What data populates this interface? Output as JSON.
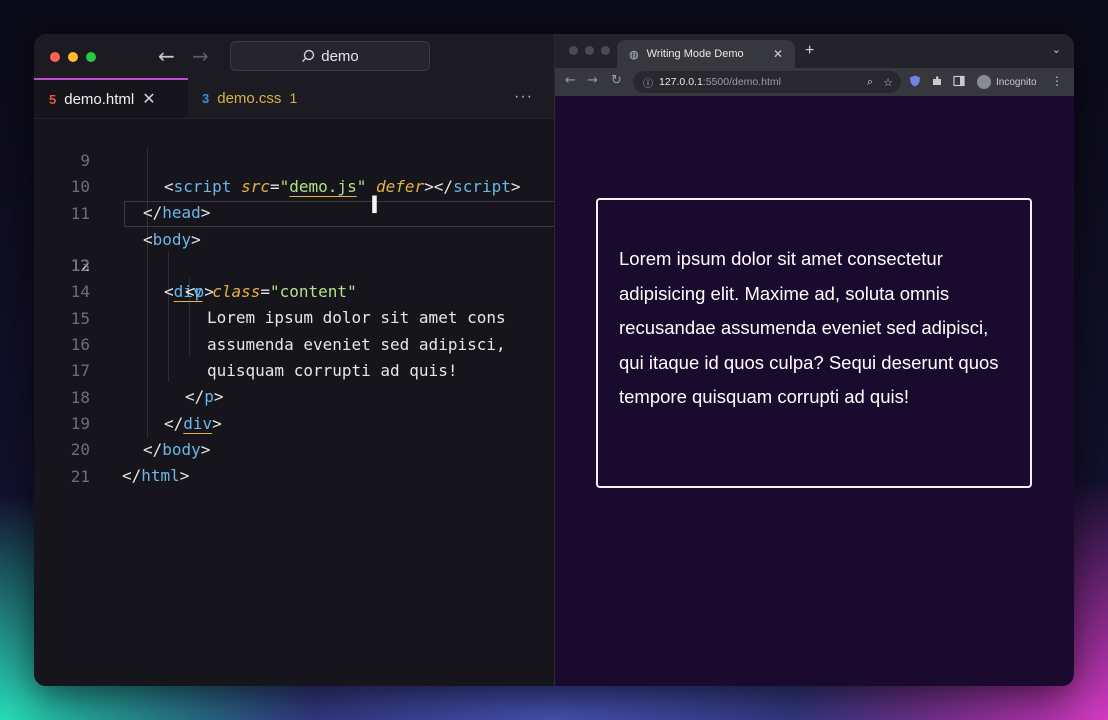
{
  "editor": {
    "command_center": "demo",
    "tabs": [
      {
        "icon": "html-file-icon",
        "label": "demo.html",
        "active": true
      },
      {
        "icon": "css-file-icon",
        "label": "demo.css",
        "problems": "1"
      }
    ],
    "line_numbers": [
      "9",
      "10",
      "11",
      "12",
      "13",
      "14",
      "15",
      "16",
      "17",
      "18",
      "19",
      "20",
      "21"
    ],
    "current_line": "12",
    "code": {
      "l9": {
        "open": "<",
        "tag": "script",
        "attr1": "src",
        "eq": "=",
        "q1": "\"",
        "val": "demo.js",
        "q2": "\"",
        "attr2": "defer",
        "close": "></",
        "tag2": "script",
        "end": ">"
      },
      "l10": {
        "open": "</",
        "tag": "head",
        "end": ">"
      },
      "l11": {
        "open": "<",
        "tag": "body",
        "end": ">"
      },
      "l12": {
        "open": "<",
        "tag": "div",
        "attr": "class",
        "eq": "=",
        "val": "\"content\""
      },
      "l13": {
        "open": "<",
        "tag": "p",
        "end": ">"
      },
      "l14": "Lorem ipsum dolor sit amet cons",
      "l15": "assumenda eveniet sed adipisci,",
      "l16": "quisquam corrupti ad quis!",
      "l17": {
        "open": "</",
        "tag": "p",
        "end": ">"
      },
      "l18": {
        "open": "</",
        "tag": "div",
        "end": ">"
      },
      "l19": {
        "open": "</",
        "tag": "body",
        "end": ">"
      },
      "l20": {
        "open": "</",
        "tag": "html",
        "end": ">"
      }
    }
  },
  "browser": {
    "tab_title": "Writing Mode Demo",
    "url_host": "127.0.0.1",
    "url_path": ":5500/demo.html",
    "profile": "Incognito",
    "paragraph": "Lorem ipsum dolor sit amet consectetur adipisicing elit. Maxime ad, soluta omnis recusandae assumenda eveniet sed adipisci, qui itaque id quos culpa? Sequi deserunt quos tempore quisquam corrupti ad quis!"
  },
  "colors": {
    "accent": "#c04bd7",
    "page_background": "#1a0a2e",
    "tag": "#6cb6e6",
    "attribute": "#e3b341",
    "string": "#b5e08a"
  }
}
